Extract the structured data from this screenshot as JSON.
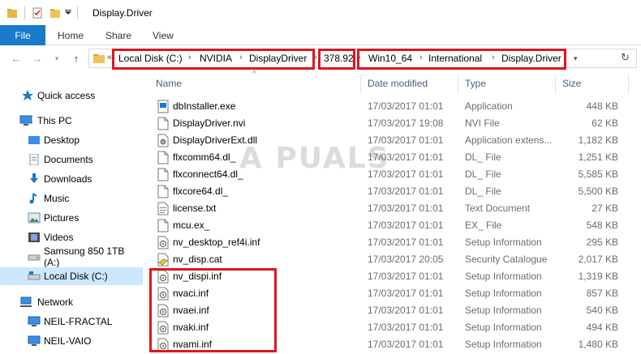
{
  "window": {
    "title": "Display.Driver"
  },
  "ribbon": {
    "tabs": [
      "File",
      "Home",
      "Share",
      "View"
    ]
  },
  "address": {
    "overflow": "«",
    "crumbs": [
      "Local Disk (C:)",
      "NVIDIA",
      "DisplayDriver",
      "378.92",
      "Win10_64",
      "International",
      "Display.Driver"
    ],
    "separator": "›"
  },
  "sidebar": {
    "items": [
      {
        "label": "Quick access",
        "icon": "star-icon"
      },
      {
        "label": "This PC",
        "icon": "computer-icon"
      },
      {
        "label": "Desktop",
        "icon": "desktop-folder-icon"
      },
      {
        "label": "Documents",
        "icon": "documents-icon"
      },
      {
        "label": "Downloads",
        "icon": "downloads-icon"
      },
      {
        "label": "Music",
        "icon": "music-icon"
      },
      {
        "label": "Pictures",
        "icon": "pictures-icon"
      },
      {
        "label": "Videos",
        "icon": "videos-icon"
      },
      {
        "label": "Samsung 850 1TB (A:)",
        "icon": "drive-icon"
      },
      {
        "label": "Local Disk (C:)",
        "icon": "local-disk-icon",
        "selected": true
      },
      {
        "label": "Network",
        "icon": "network-icon"
      },
      {
        "label": "NEIL-FRACTAL",
        "icon": "computer-icon"
      },
      {
        "label": "NEIL-VAIO",
        "icon": "computer-icon"
      }
    ]
  },
  "columns": {
    "name": "Name",
    "date": "Date modified",
    "type": "Type",
    "size": "Size"
  },
  "files": [
    {
      "name": "dbInstaller.exe",
      "date": "17/03/2017 01:01",
      "type": "Application",
      "size": "448 KB",
      "icon": "exe"
    },
    {
      "name": "DisplayDriver.nvi",
      "date": "17/03/2017 19:08",
      "type": "NVI File",
      "size": "62 KB",
      "icon": "file"
    },
    {
      "name": "DisplayDriverExt.dll",
      "date": "17/03/2017 01:01",
      "type": "Application extens...",
      "size": "1,182 KB",
      "icon": "dll"
    },
    {
      "name": "flxcomm64.dl_",
      "date": "17/03/2017 01:01",
      "type": "DL_ File",
      "size": "1,251 KB",
      "icon": "file"
    },
    {
      "name": "flxconnect64.dl_",
      "date": "17/03/2017 01:01",
      "type": "DL_ File",
      "size": "5,585 KB",
      "icon": "file"
    },
    {
      "name": "flxcore64.dl_",
      "date": "17/03/2017 01:01",
      "type": "DL_ File",
      "size": "5,500 KB",
      "icon": "file"
    },
    {
      "name": "license.txt",
      "date": "17/03/2017 01:01",
      "type": "Text Document",
      "size": "27 KB",
      "icon": "txt"
    },
    {
      "name": "mcu.ex_",
      "date": "17/03/2017 01:01",
      "type": "EX_ File",
      "size": "548 KB",
      "icon": "file"
    },
    {
      "name": "nv_desktop_ref4i.inf",
      "date": "17/03/2017 01:01",
      "type": "Setup Information",
      "size": "295 KB",
      "icon": "inf"
    },
    {
      "name": "nv_disp.cat",
      "date": "17/03/2017 20:05",
      "type": "Security Catalogue",
      "size": "2,017 KB",
      "icon": "cat"
    },
    {
      "name": "nv_dispi.inf",
      "date": "17/03/2017 01:01",
      "type": "Setup Information",
      "size": "1,319 KB",
      "icon": "inf"
    },
    {
      "name": "nvaci.inf",
      "date": "17/03/2017 01:01",
      "type": "Setup Information",
      "size": "857 KB",
      "icon": "inf"
    },
    {
      "name": "nvaei.inf",
      "date": "17/03/2017 01:01",
      "type": "Setup Information",
      "size": "540 KB",
      "icon": "inf"
    },
    {
      "name": "nvaki.inf",
      "date": "17/03/2017 01:01",
      "type": "Setup Information",
      "size": "494 KB",
      "icon": "inf"
    },
    {
      "name": "nvami.inf",
      "date": "17/03/2017 01:01",
      "type": "Setup Information",
      "size": "1,480 KB",
      "icon": "inf"
    }
  ],
  "watermark": "A PUALS",
  "colors": {
    "accent": "#1979ca",
    "highlight": "#e0151f",
    "selected": "#cce8ff"
  }
}
